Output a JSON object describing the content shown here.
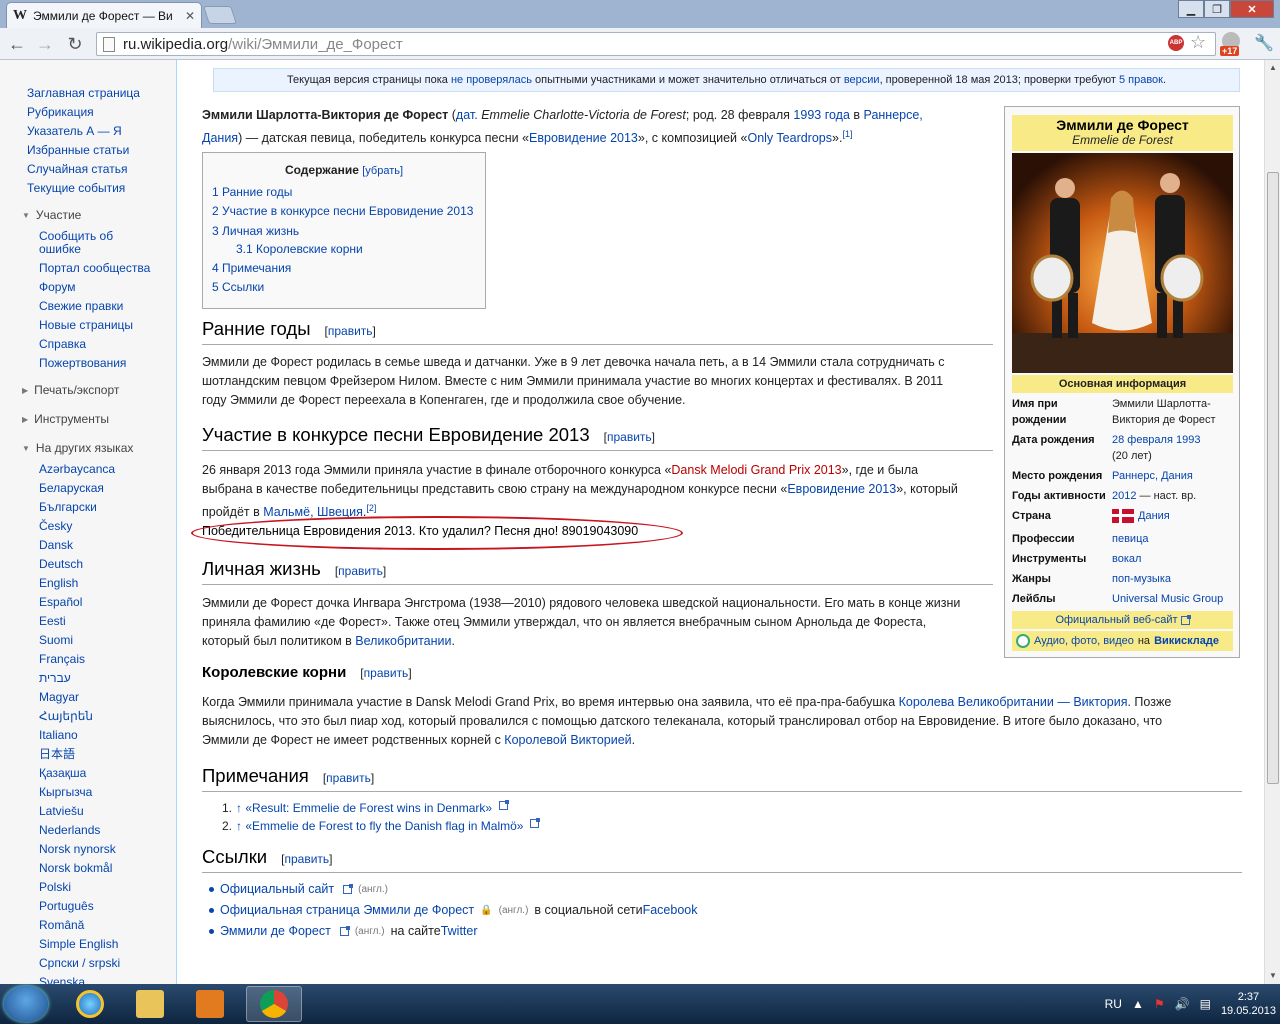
{
  "browser": {
    "tab_title": "Эммили де Форест — Ви",
    "tab_favicon": "W",
    "url_host": "ru.wikipedia.org",
    "url_path": "/wiki/Эммили_де_Форест",
    "abp_label": "ABP",
    "ext_badge": "+17"
  },
  "sidebar": {
    "main": [
      "Заглавная страница",
      "Рубрикация",
      "Указатель А — Я",
      "Избранные статьи",
      "Случайная статья",
      "Текущие события"
    ],
    "participation_head": "Участие",
    "participation": [
      "Сообщить об",
      "ошибке",
      "Портал сообщества",
      "Форум",
      "Свежие правки",
      "Новые страницы",
      "Справка",
      "Пожертвования"
    ],
    "print_head": "Печать/экспорт",
    "tools_head": "Инструменты",
    "languages_head": "На других языках",
    "languages": [
      "Azərbaycanca",
      "Беларуская",
      "Български",
      "Česky",
      "Dansk",
      "Deutsch",
      "English",
      "Español",
      "Eesti",
      "Suomi",
      "Français",
      "עברית",
      "Magyar",
      "Հայերեն",
      "Italiano",
      "日本語",
      "Қазақша",
      "Кыргызча",
      "Latviešu",
      "Nederlands",
      "Norsk nynorsk",
      "Norsk bokmål",
      "Polski",
      "Português",
      "Română",
      "Simple English",
      "Српски / srpski",
      "Svenska"
    ]
  },
  "notice": {
    "pre": "Текущая версия страницы пока ",
    "link1": "не проверялась",
    "mid": " опытными участниками и может значительно отличаться от ",
    "link2": "версии",
    "post": ", проверенной 18 мая 2013; проверки требуют ",
    "link3": "5 правок",
    "end": "."
  },
  "intro": {
    "name": "Эммили Шарлотта-Виктория де Форест",
    "lang_link": "дат.",
    "orig": " Emmelie Charlotte-Victoria de Forest",
    "born": "; род. 28 февраля ",
    "year_link": "1993 года",
    "in": " в ",
    "place_link": "Раннерсе,",
    "line2_link": "Дания",
    "line2": ") — датская певица, победитель конкурса песни «",
    "euro_link": "Евровидение 2013",
    "line2b": "», с композицией «",
    "song_link": "Only Teardrops",
    "line2c": "».",
    "ref": "[1]"
  },
  "toc": {
    "title": "Содержание",
    "hide": "[убрать]",
    "items": [
      "1 Ранние годы",
      "2 Участие в конкурсе песни Евровидение 2013",
      "3 Личная жизнь",
      "3.1 Королевские корни",
      "4 Примечания",
      "5 Ссылки"
    ]
  },
  "edit_label": "править",
  "sections": {
    "early": {
      "title": "Ранние годы",
      "text": [
        "Эммили де Форест родилась в семье шведа и датчанки. Уже в 9 лет девочка начала петь, а в 14 Эммили стала сотрудничать с",
        "шотландским певцом Фрейзером Нилом. Вместе с ним Эммили принимала участие во многих концертах и фестивалях. В 2011",
        "году Эммили де Форест переехала в Копенгаген, где и продолжила свое обучение."
      ]
    },
    "euro": {
      "title": "Участие в конкурсе песни Евровидение 2013",
      "l1": "26 января 2013 года Эммили приняла участие в финале отборочного конкурса «",
      "l1_link": "Dansk Melodi Grand Prix 2013",
      "l1b": "», где и была",
      "l2": "выбрана в качестве победительницы представить свою страну на международном конкурсе песни «",
      "l2_link": "Евровидение 2013",
      "l2b": "», который",
      "l3": "пройдёт в ",
      "l3_link": "Мальмё, Швеция",
      "l3b": ".",
      "ref": "[2]",
      "vandal": "Победительница Евровидения 2013. Кто удалил? Песня дно! 89019043090"
    },
    "personal": {
      "title": "Личная жизнь",
      "l1": "Эммили де Форест дочка Ингвара Энгстрома (1938—2010) рядового человека шведской национальности. Его мать в конце жизни",
      "l2": "приняла фамилию «де Форест». Также отец Эммили утверждал, что он является внебрачным сыном Арнольда де Фореста,",
      "l3": "который был политиком в ",
      "l3_link": "Великобритании",
      "l3b": "."
    },
    "royal": {
      "title": "Королевские корни",
      "l1": "Когда Эммили принимала участие в Dansk Melodi Grand Prix, во время интервью она заявила, что её пра-пра-бабушка ",
      "l1_link": "Королева Великобритании — Виктория",
      "l1b": ". Позже",
      "l2": "выяснилось, что это был пиар ход, который провалился с помощью датского телеканала, который транслировал отбор на Евровидение. В итоге было доказано, что",
      "l3": "Эммили де Форест не имеет родственных корней с ",
      "l3_link": "Королевой Викторией",
      "l3b": "."
    },
    "notes": {
      "title": "Примечания",
      "items": [
        {
          "num": "1.",
          "text": "↑ «Result: Emmelie de Forest wins in Denmark»"
        },
        {
          "num": "2.",
          "text": "↑ «Emmelie de Forest to fly the Danish flag in Malmö»"
        }
      ]
    },
    "links": {
      "title": "Ссылки",
      "items": [
        {
          "link": "Официальный сайт",
          "note": "(англ.)",
          "tail": "",
          "tail_link": ""
        },
        {
          "link": "Официальная страница Эммили де Форест",
          "note": "(англ.)",
          "tail": " в социальной сети ",
          "tail_link": "Facebook"
        },
        {
          "link": "Эммили де Форест",
          "note": "(англ.)",
          "tail": " на сайте ",
          "tail_link": "Twitter"
        }
      ]
    }
  },
  "infobox": {
    "name": "Эммили де Форест",
    "orig": "Emmelie de Forest",
    "section": "Основная информация",
    "rows": [
      {
        "k": "Имя при рождении",
        "v": "Эммили Шарлотта-Виктория де Форест"
      },
      {
        "k": "Дата рождения",
        "v": "28 февраля 1993",
        "v2": "(20 лет)"
      },
      {
        "k": "Место рождения",
        "v": "Раннерс, Дания"
      },
      {
        "k": "Годы активности",
        "v": "2012",
        "v2": " — наст. вр."
      },
      {
        "k": "Страна",
        "v": "Дания"
      },
      {
        "k": "Профессии",
        "v": "певица"
      },
      {
        "k": "Инструменты",
        "v": "вокал"
      },
      {
        "k": "Жанры",
        "v": "поп-музыка"
      },
      {
        "k": "Лейблы",
        "v": "Universal Music Group"
      }
    ],
    "site": "Официальный веб-сайт",
    "commons_link": "Аудио, фото, видео",
    "commons_mid": " на ",
    "commons_b": "Викискладе"
  },
  "taskbar": {
    "lang": "RU",
    "time": "2:37",
    "date": "19.05.2013"
  },
  "colors": {
    "link": "#0645ad",
    "infobox_header": "#f8eb87",
    "vandal_circle": "#c8141e",
    "taskbar": "#1b3656"
  }
}
